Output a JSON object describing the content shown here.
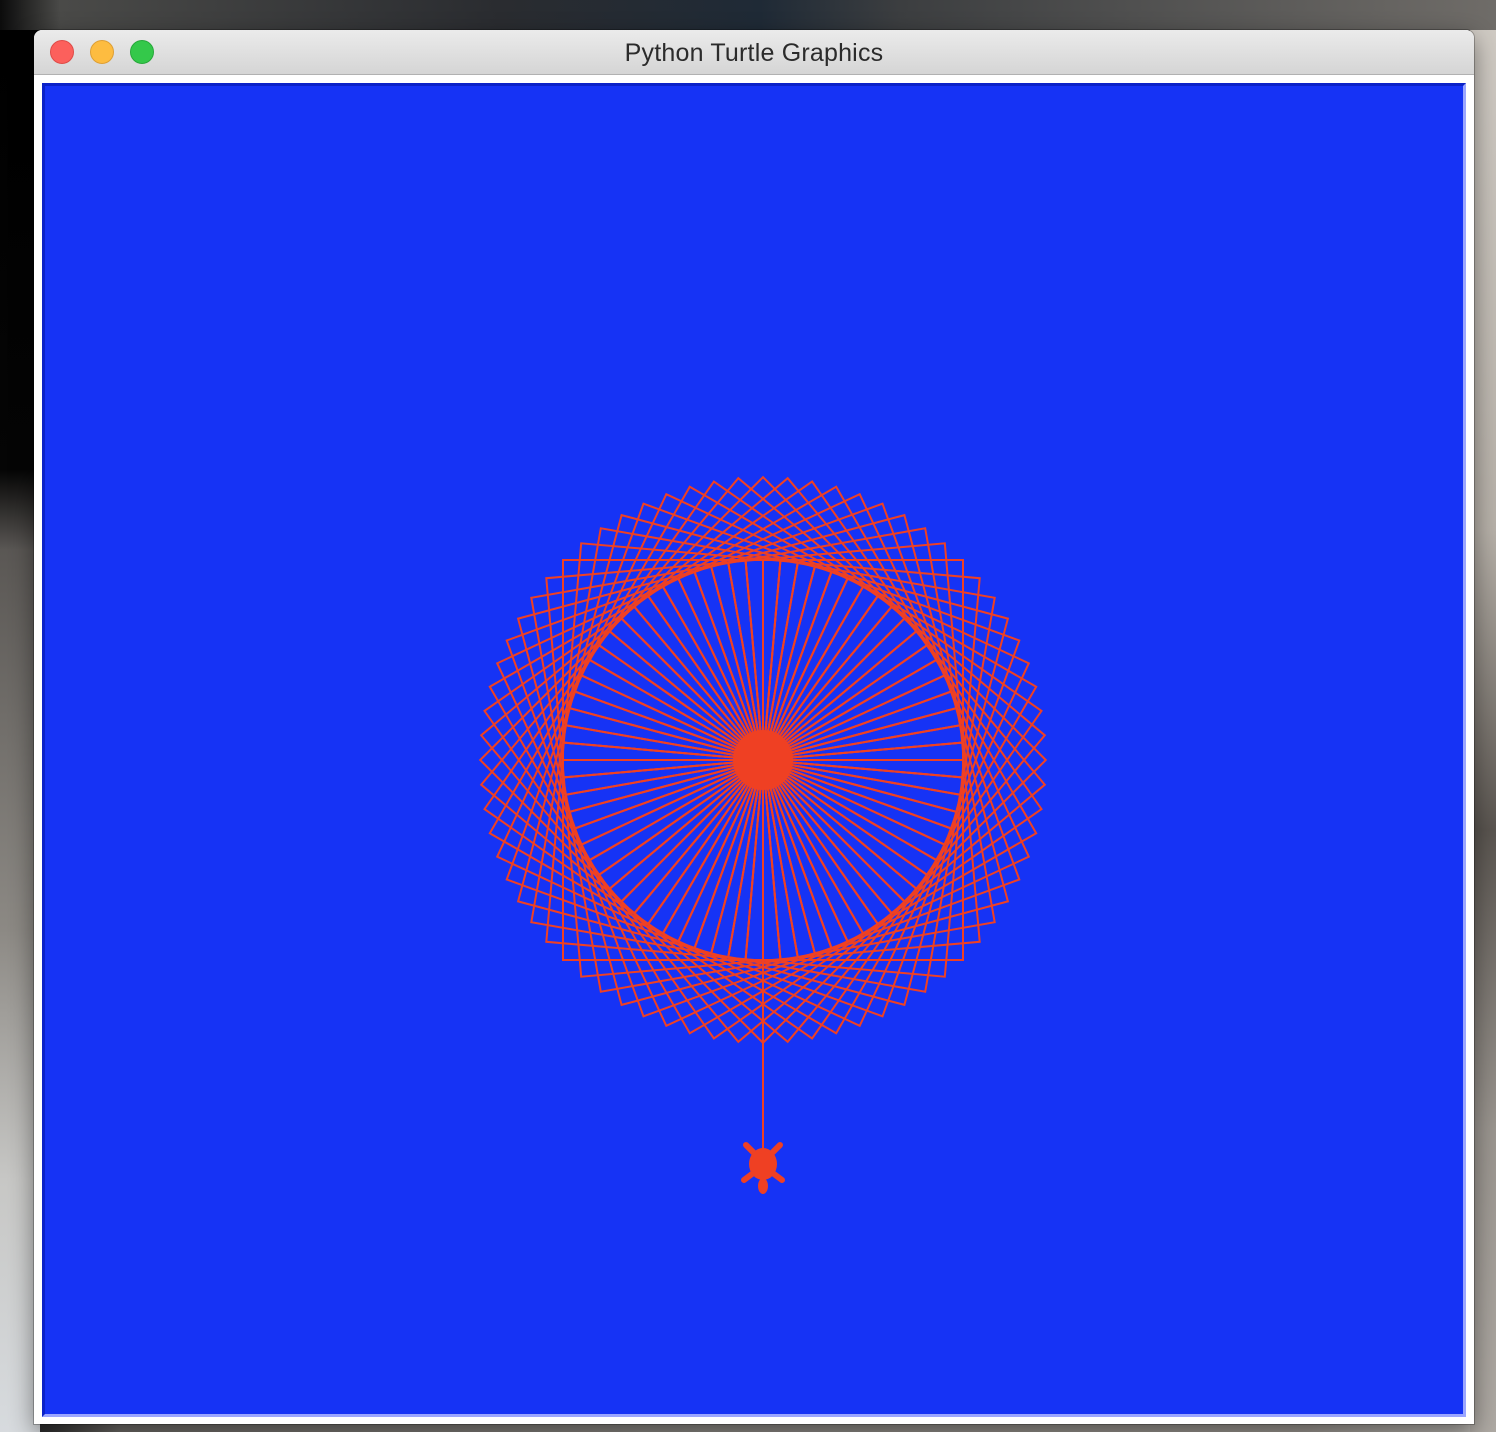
{
  "window": {
    "title": "Python Turtle Graphics"
  },
  "canvas": {
    "background_color": "#1633f5",
    "pen_color": "#ef4023"
  },
  "drawing": {
    "square_count": 72,
    "spoke_count": 72,
    "turtle_shape": "turtle-icon"
  }
}
